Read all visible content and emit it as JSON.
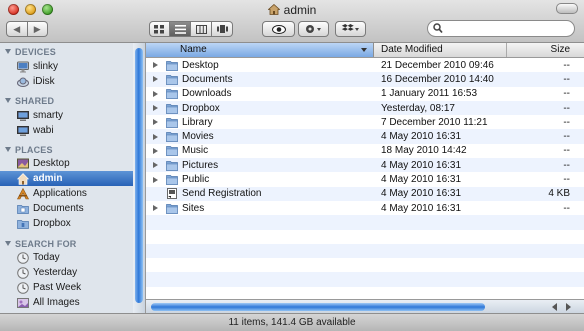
{
  "window": {
    "title": "admin"
  },
  "toolbar": {
    "back_glyph": "◀",
    "forward_glyph": "▶",
    "view_modes": [
      "icon-view",
      "list-view",
      "column-view",
      "coverflow-view"
    ],
    "active_view": "list-view",
    "search_placeholder": ""
  },
  "sidebar": {
    "sections": [
      {
        "header": "DEVICES",
        "items": [
          {
            "label": "slinky",
            "icon": "imac-icon"
          },
          {
            "label": "iDisk",
            "icon": "idisk-icon"
          }
        ]
      },
      {
        "header": "SHARED",
        "items": [
          {
            "label": "smarty",
            "icon": "monitor-icon"
          },
          {
            "label": "wabi",
            "icon": "monitor-icon"
          }
        ]
      },
      {
        "header": "PLACES",
        "items": [
          {
            "label": "Desktop",
            "icon": "desktop-icon"
          },
          {
            "label": "admin",
            "icon": "home-icon",
            "selected": true
          },
          {
            "label": "Applications",
            "icon": "applications-icon"
          },
          {
            "label": "Documents",
            "icon": "documents-folder-icon"
          },
          {
            "label": "Dropbox",
            "icon": "dropbox-folder-icon"
          }
        ]
      },
      {
        "header": "SEARCH FOR",
        "items": [
          {
            "label": "Today",
            "icon": "clock-icon"
          },
          {
            "label": "Yesterday",
            "icon": "clock-icon"
          },
          {
            "label": "Past Week",
            "icon": "clock-icon"
          },
          {
            "label": "All Images",
            "icon": "images-icon"
          }
        ]
      }
    ]
  },
  "list": {
    "columns": {
      "name": "Name",
      "date": "Date Modified",
      "size": "Size"
    },
    "rows": [
      {
        "name": "Desktop",
        "date": "21 December 2010 09:46",
        "size": "--",
        "icon": "folder-icon"
      },
      {
        "name": "Documents",
        "date": "16 December 2010 14:40",
        "size": "--",
        "icon": "folder-icon"
      },
      {
        "name": "Downloads",
        "date": "1 January 2011 16:53",
        "size": "--",
        "icon": "folder-icon"
      },
      {
        "name": "Dropbox",
        "date": "Yesterday, 08:17",
        "size": "--",
        "icon": "folder-icon"
      },
      {
        "name": "Library",
        "date": "7 December 2010 11:21",
        "size": "--",
        "icon": "folder-icon"
      },
      {
        "name": "Movies",
        "date": "4 May 2010 16:31",
        "size": "--",
        "icon": "folder-icon"
      },
      {
        "name": "Music",
        "date": "18 May 2010 14:42",
        "size": "--",
        "icon": "folder-icon"
      },
      {
        "name": "Pictures",
        "date": "4 May 2010 16:31",
        "size": "--",
        "icon": "folder-icon"
      },
      {
        "name": "Public",
        "date": "4 May 2010 16:31",
        "size": "--",
        "icon": "folder-icon"
      },
      {
        "name": "Send Registration",
        "date": "4 May 2010 16:31",
        "size": "4 KB",
        "icon": "alias-document-icon"
      },
      {
        "name": "Sites",
        "date": "4 May 2010 16:31",
        "size": "--",
        "icon": "folder-icon"
      }
    ]
  },
  "status": {
    "text": "11 items, 141.4 GB available"
  },
  "colors": {
    "selection": "#2862b6",
    "sidebar_bg": "#dfe5ec",
    "row_alt": "#edf3fe",
    "folder": "#7fa6d6"
  }
}
